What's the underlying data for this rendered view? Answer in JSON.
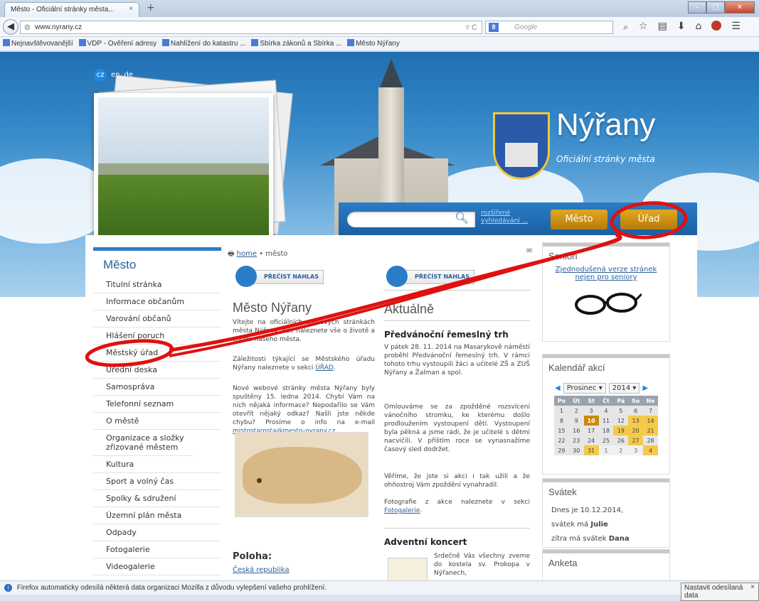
{
  "browser": {
    "tab_title": "Město - Oficiální stránky města...",
    "tab_close": "×",
    "new_tab": "+",
    "url": "www.nyrany.cz",
    "search_placeholder": "Google",
    "search_engine_icon": "8",
    "bookmarks": [
      "Nejnavštěvovanější",
      "VDP - Ověření adresy",
      "Nahlížení do katastru ...",
      "Sbírka zákonů a Sbírka ...",
      "Město Nýřany"
    ]
  },
  "site": {
    "languages": [
      "cz",
      "en",
      "de"
    ],
    "title": "Nýřany",
    "subtitle": "Oficiální stránky města",
    "search_advanced": "rozšířené vyhledávání ...",
    "nav_buttons": [
      "Město",
      "Úřad"
    ]
  },
  "left_nav": {
    "heading": "Město",
    "items": [
      "Titulní stránka",
      "Informace občanům",
      "Varování občanů",
      "Hlášení poruch",
      "Městský úřad",
      "Úřední deska",
      "Samospráva",
      "Telefonní seznam",
      "O městě",
      "Organizace a složky zřizované městem",
      "Kultura",
      "Sport a volný čas",
      "Spolky & sdružení",
      "Územní plán města",
      "Odpady",
      "Fotogalerie",
      "Videogalerie"
    ]
  },
  "main": {
    "breadcrumb_home": "home",
    "breadcrumb_sep": "•",
    "breadcrumb_current": "město",
    "read_aloud": "PŘEČÍST NAHLAS",
    "title": "Město Nýřany",
    "p1": "Vítejte na oficiálních webových stránkách města Nýřany, kde naleznete vše o životě a chodu našeho města.",
    "p2_pre": "Záležitosti týkající se Městského úřadu Nýřany naleznete v sekci",
    "p2_link": "ÚŘAD",
    "p3": "Nové webové stránky města Nýřany byly spuštěny 15. ledna 2014. Chybí Vám na nich nějaká informace? Nepodařilo se Vám otevřít nějaký odkaz? Našli jste někde chybu? Prosíme o info na e-mail",
    "email": "mistostarosta@mesto-nyrany.cz",
    "location_title": "Poloha:",
    "location_link": "Česká republika"
  },
  "news": {
    "title": "Aktuálně",
    "read_aloud": "PŘEČÍST NAHLAS",
    "article1_title": "Předvánoční řemeslný trh",
    "article1_p1": "V pátek 28. 11. 2014 na Masarykově náměstí proběhl Předvánoční řemeslný trh. V rámci tohoto trhu vystoupili žáci a učitelé ZŠ a ZUŠ Nýřany a Žalman a spol.",
    "article1_p2": "Omlouváme se za zpožděné rozsvícení vánočního stromku, ke kterému došlo prodloužením vystoupení dětí. Vystoupení byla pěkná a jsme rádi, že je učitelé s dětmi nacvičili. V příštím roce se vynasnažíme časový sled dodržet.",
    "article1_p3": "Věříme, že jste si akci i tak užili a že ohňostroj Vám zpoždění vynahradil.",
    "article1_p4_pre": "Fotografie z akce naleznete v sekci",
    "article1_p4_link": "Fotogalerie",
    "article2_title": "Adventní koncert",
    "article2_text": "Srdečně Vás všechny zveme do kostela sv. Prokopa v Nýřanech,"
  },
  "sidebar": {
    "seniors_title": "Senioři",
    "seniors_link": "Zjednodušená verze stránek nejen pro seniory",
    "calendar_title": "Kalendář akcí",
    "calendar_month": "Prosinec",
    "calendar_year": "2014",
    "weekdays": [
      "Po",
      "Út",
      "St",
      "Čt",
      "Pá",
      "So",
      "Ne"
    ],
    "weeks": [
      [
        "1",
        "2",
        "3",
        "4",
        "5",
        "6",
        "7"
      ],
      [
        "8",
        "9",
        "10",
        "11",
        "12",
        "13",
        "14"
      ],
      [
        "15",
        "16",
        "17",
        "18",
        "19",
        "20",
        "21"
      ],
      [
        "22",
        "23",
        "24",
        "25",
        "26",
        "27",
        "28"
      ],
      [
        "29",
        "30",
        "31",
        "1",
        "2",
        "3",
        "4"
      ]
    ],
    "holiday_title": "Svátek",
    "holiday_today_pre": "Dnes je 10.12.2014,",
    "holiday_today_name_pre": "svátek má",
    "holiday_today_name": "Julie",
    "holiday_tomorrow_pre": "zítra má svátek",
    "holiday_tomorrow_name": "Dana",
    "poll_title": "Anketa"
  },
  "statusbar": {
    "message": "Firefox automaticky odesílá některá data organizaci Mozilla z důvodu vylepšení vašeho prohlížení.",
    "button": "Nastavit odesílaná data",
    "close": "×"
  },
  "colors": {
    "accent": "#2b7cc6",
    "gold": "#d39a16",
    "annotation": "#e01010"
  }
}
